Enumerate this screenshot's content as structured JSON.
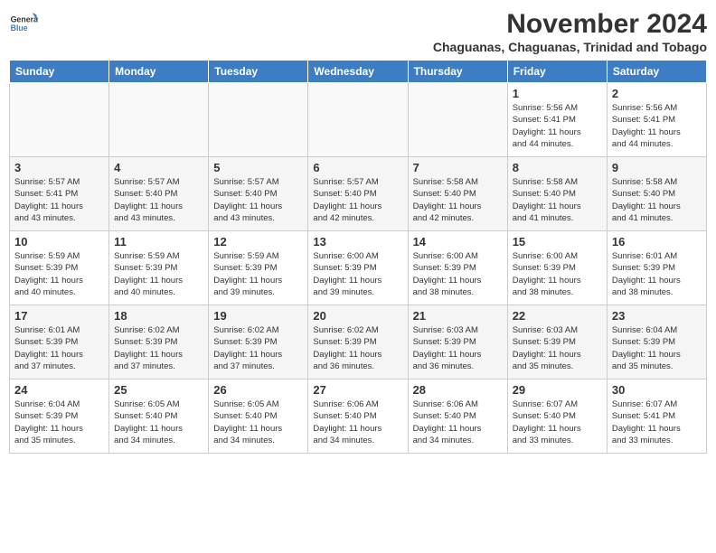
{
  "header": {
    "logo_line1": "General",
    "logo_line2": "Blue",
    "month": "November 2024",
    "location": "Chaguanas, Chaguanas, Trinidad and Tobago"
  },
  "weekdays": [
    "Sunday",
    "Monday",
    "Tuesday",
    "Wednesday",
    "Thursday",
    "Friday",
    "Saturday"
  ],
  "weeks": [
    [
      {
        "day": "",
        "info": ""
      },
      {
        "day": "",
        "info": ""
      },
      {
        "day": "",
        "info": ""
      },
      {
        "day": "",
        "info": ""
      },
      {
        "day": "",
        "info": ""
      },
      {
        "day": "1",
        "info": "Sunrise: 5:56 AM\nSunset: 5:41 PM\nDaylight: 11 hours\nand 44 minutes."
      },
      {
        "day": "2",
        "info": "Sunrise: 5:56 AM\nSunset: 5:41 PM\nDaylight: 11 hours\nand 44 minutes."
      }
    ],
    [
      {
        "day": "3",
        "info": "Sunrise: 5:57 AM\nSunset: 5:41 PM\nDaylight: 11 hours\nand 43 minutes."
      },
      {
        "day": "4",
        "info": "Sunrise: 5:57 AM\nSunset: 5:40 PM\nDaylight: 11 hours\nand 43 minutes."
      },
      {
        "day": "5",
        "info": "Sunrise: 5:57 AM\nSunset: 5:40 PM\nDaylight: 11 hours\nand 43 minutes."
      },
      {
        "day": "6",
        "info": "Sunrise: 5:57 AM\nSunset: 5:40 PM\nDaylight: 11 hours\nand 42 minutes."
      },
      {
        "day": "7",
        "info": "Sunrise: 5:58 AM\nSunset: 5:40 PM\nDaylight: 11 hours\nand 42 minutes."
      },
      {
        "day": "8",
        "info": "Sunrise: 5:58 AM\nSunset: 5:40 PM\nDaylight: 11 hours\nand 41 minutes."
      },
      {
        "day": "9",
        "info": "Sunrise: 5:58 AM\nSunset: 5:40 PM\nDaylight: 11 hours\nand 41 minutes."
      }
    ],
    [
      {
        "day": "10",
        "info": "Sunrise: 5:59 AM\nSunset: 5:39 PM\nDaylight: 11 hours\nand 40 minutes."
      },
      {
        "day": "11",
        "info": "Sunrise: 5:59 AM\nSunset: 5:39 PM\nDaylight: 11 hours\nand 40 minutes."
      },
      {
        "day": "12",
        "info": "Sunrise: 5:59 AM\nSunset: 5:39 PM\nDaylight: 11 hours\nand 39 minutes."
      },
      {
        "day": "13",
        "info": "Sunrise: 6:00 AM\nSunset: 5:39 PM\nDaylight: 11 hours\nand 39 minutes."
      },
      {
        "day": "14",
        "info": "Sunrise: 6:00 AM\nSunset: 5:39 PM\nDaylight: 11 hours\nand 38 minutes."
      },
      {
        "day": "15",
        "info": "Sunrise: 6:00 AM\nSunset: 5:39 PM\nDaylight: 11 hours\nand 38 minutes."
      },
      {
        "day": "16",
        "info": "Sunrise: 6:01 AM\nSunset: 5:39 PM\nDaylight: 11 hours\nand 38 minutes."
      }
    ],
    [
      {
        "day": "17",
        "info": "Sunrise: 6:01 AM\nSunset: 5:39 PM\nDaylight: 11 hours\nand 37 minutes."
      },
      {
        "day": "18",
        "info": "Sunrise: 6:02 AM\nSunset: 5:39 PM\nDaylight: 11 hours\nand 37 minutes."
      },
      {
        "day": "19",
        "info": "Sunrise: 6:02 AM\nSunset: 5:39 PM\nDaylight: 11 hours\nand 37 minutes."
      },
      {
        "day": "20",
        "info": "Sunrise: 6:02 AM\nSunset: 5:39 PM\nDaylight: 11 hours\nand 36 minutes."
      },
      {
        "day": "21",
        "info": "Sunrise: 6:03 AM\nSunset: 5:39 PM\nDaylight: 11 hours\nand 36 minutes."
      },
      {
        "day": "22",
        "info": "Sunrise: 6:03 AM\nSunset: 5:39 PM\nDaylight: 11 hours\nand 35 minutes."
      },
      {
        "day": "23",
        "info": "Sunrise: 6:04 AM\nSunset: 5:39 PM\nDaylight: 11 hours\nand 35 minutes."
      }
    ],
    [
      {
        "day": "24",
        "info": "Sunrise: 6:04 AM\nSunset: 5:39 PM\nDaylight: 11 hours\nand 35 minutes."
      },
      {
        "day": "25",
        "info": "Sunrise: 6:05 AM\nSunset: 5:40 PM\nDaylight: 11 hours\nand 34 minutes."
      },
      {
        "day": "26",
        "info": "Sunrise: 6:05 AM\nSunset: 5:40 PM\nDaylight: 11 hours\nand 34 minutes."
      },
      {
        "day": "27",
        "info": "Sunrise: 6:06 AM\nSunset: 5:40 PM\nDaylight: 11 hours\nand 34 minutes."
      },
      {
        "day": "28",
        "info": "Sunrise: 6:06 AM\nSunset: 5:40 PM\nDaylight: 11 hours\nand 34 minutes."
      },
      {
        "day": "29",
        "info": "Sunrise: 6:07 AM\nSunset: 5:40 PM\nDaylight: 11 hours\nand 33 minutes."
      },
      {
        "day": "30",
        "info": "Sunrise: 6:07 AM\nSunset: 5:41 PM\nDaylight: 11 hours\nand 33 minutes."
      }
    ]
  ]
}
